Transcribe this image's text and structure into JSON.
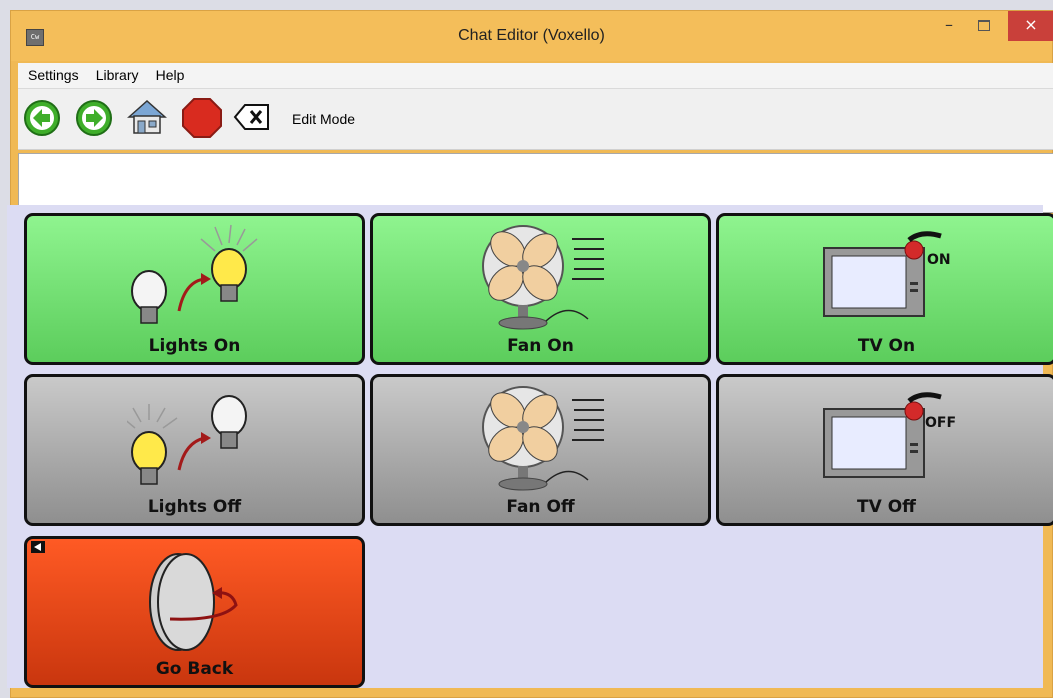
{
  "window": {
    "title": "Chat Editor (Voxello)",
    "minimize_label": "–",
    "close_label": "×"
  },
  "menu": {
    "items": [
      "Settings",
      "Library",
      "Help"
    ]
  },
  "toolbar": {
    "buttons": [
      "back-icon",
      "forward-icon",
      "home-icon",
      "stop-icon",
      "clear-icon"
    ],
    "edit_mode_label": "Edit Mode"
  },
  "message_bar": {
    "value": ""
  },
  "tiles": [
    {
      "label": "Lights On",
      "color": "#6ee06e",
      "icon": "lights-on-icon"
    },
    {
      "label": "Fan On",
      "color": "#6ee06e",
      "icon": "fan-icon"
    },
    {
      "label": "TV On",
      "color": "#6ee06e",
      "icon": "tv-on-icon"
    },
    {
      "label": "Lights Off",
      "color": "#a9a9a9",
      "icon": "lights-off-icon"
    },
    {
      "label": "Fan Off",
      "color": "#a9a9a9",
      "icon": "fan-icon"
    },
    {
      "label": "TV Off",
      "color": "#a9a9a9",
      "icon": "tv-off-icon"
    },
    {
      "label": "Go Back",
      "color": "#e9471a",
      "icon": "go-back-icon"
    }
  ],
  "tv_badges": {
    "on": "ON",
    "off": "OFF"
  },
  "colors": {
    "title_bar": "#f4be5a",
    "close_button": "#c9403a",
    "grid_background": "#dcdcf3"
  }
}
